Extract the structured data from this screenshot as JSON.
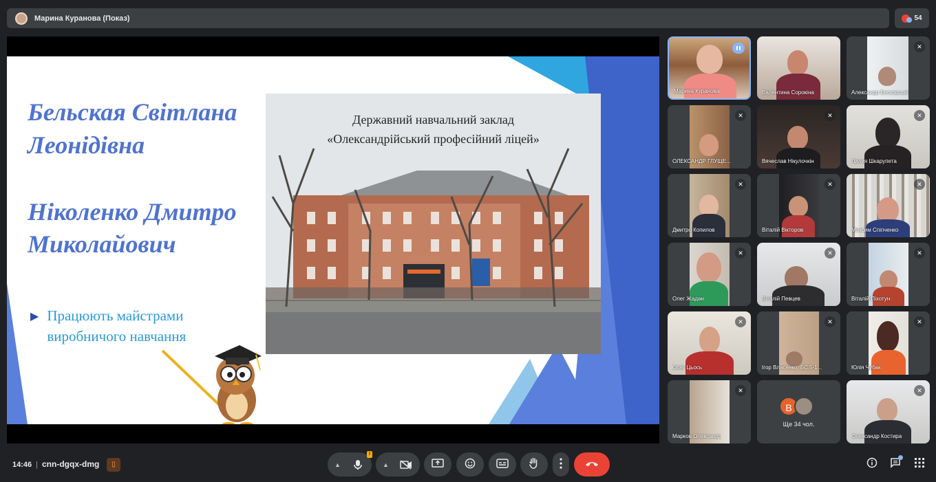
{
  "header": {
    "presenter": "Марина Куранова (Показ)",
    "participant_count": "54"
  },
  "slide": {
    "name1_line1": "Бельская Світлана",
    "name1_line2": "Леонідівна",
    "name2_line1": "Ніколенко Дмитро",
    "name2_line2": "Миколайович",
    "bullet_marker": "▶",
    "bullet_text": "Працюють майстрами виробничого навчання",
    "photo_caption_line1": "Державний навчальний заклад",
    "photo_caption_line2": "«Олександрійський професійний ліцей»",
    "colors": {
      "accent": "#4f73cf",
      "bullet": "#2a9ad6"
    }
  },
  "participants": [
    {
      "name": "Марина Куранова",
      "state": "speaking"
    },
    {
      "name": "Валентина Сорокіна",
      "state": ""
    },
    {
      "name": "Александр Бескорсый",
      "state": "muted"
    },
    {
      "name": "ОЛЕКСАНДР ГЛУЩЕ...",
      "state": "muted"
    },
    {
      "name": "Вячеслав Нікулочкін",
      "state": "muted"
    },
    {
      "name": "Лилия Шкарупета",
      "state": "muted"
    },
    {
      "name": "Дмитро Копилов",
      "state": "muted"
    },
    {
      "name": "Віталій Вікторов",
      "state": "muted"
    },
    {
      "name": "Максим Спіпченко",
      "state": "muted"
    },
    {
      "name": "Олег Жадан",
      "state": "muted"
    },
    {
      "name": "Віталій Певцев",
      "state": "muted"
    },
    {
      "name": "Віталій Піхотун",
      "state": "muted"
    },
    {
      "name": "Олег Цьось",
      "state": "muted"
    },
    {
      "name": "Ігор Власенко. БС.5-1...",
      "state": "muted"
    },
    {
      "name": "Юлія Чубак",
      "state": "muted"
    },
    {
      "name": "Марков Олександр",
      "state": "muted"
    },
    {
      "name": "",
      "state": ""
    },
    {
      "name": "Олександр Костира",
      "state": "muted"
    }
  ],
  "more_tile": {
    "initial": "В",
    "label": "Ще 34 чол."
  },
  "bottom": {
    "time": "14:46",
    "separator": "|",
    "meeting_code": "cnn-dgqx-dmg",
    "warning": "!"
  },
  "icons": [
    "mic-icon",
    "camera-off-icon",
    "present-icon",
    "emoji-icon",
    "captions-icon",
    "raise-hand-icon",
    "more-options-icon",
    "end-call-icon",
    "info-icon",
    "chat-icon",
    "activities-icon"
  ]
}
